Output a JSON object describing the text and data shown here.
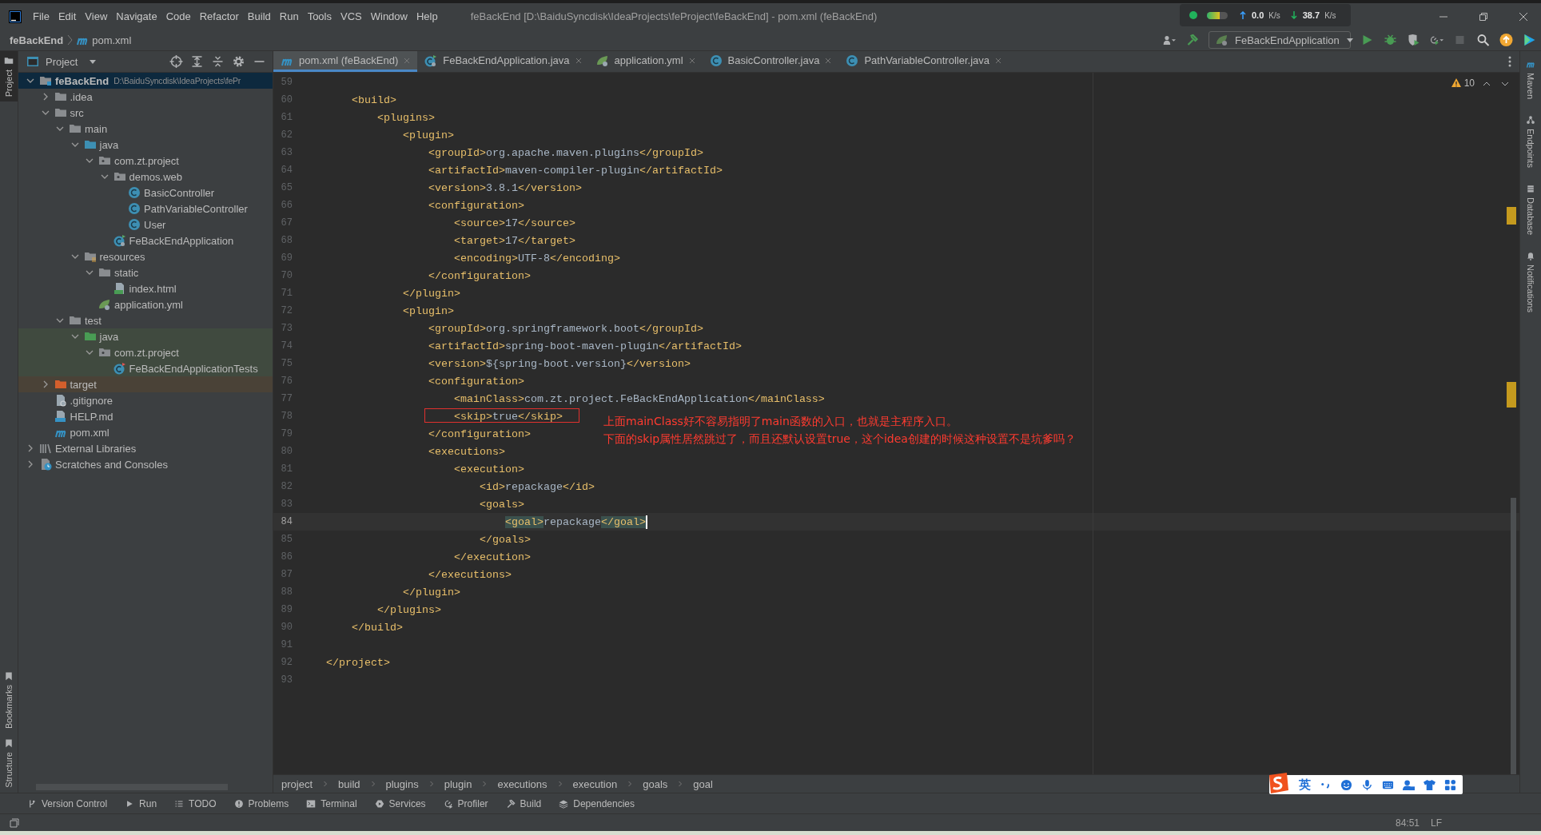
{
  "title_bar": {
    "menu": [
      "File",
      "Edit",
      "View",
      "Navigate",
      "Code",
      "Refactor",
      "Build",
      "Run",
      "Tools",
      "VCS",
      "Window",
      "Help"
    ],
    "title": "feBackEnd [D:\\BaiduSyncdisk\\IdeaProjects\\feProject\\feBackEnd] - pom.xml (feBackEnd)",
    "net_meter": {
      "level": 0.6,
      "up": "0.0",
      "up_unit": "K/s",
      "down": "38.7",
      "down_unit": "K/s"
    }
  },
  "nav_bar": {
    "crumbs": [
      "feBackEnd",
      "pom.xml"
    ],
    "run_config": "FeBackEndApplication"
  },
  "left_strip": {
    "top": [
      {
        "label": "Project",
        "selected": true
      }
    ],
    "bottom": [
      {
        "label": "Bookmarks",
        "selected": false
      },
      {
        "label": "Structure",
        "selected": false
      }
    ]
  },
  "project_panel": {
    "title": "Project",
    "tree": [
      {
        "label": "feBackEnd",
        "path": "D:\\BaiduSyncdisk\\IdeaProjects\\fePr",
        "kind": "module",
        "expanded": true,
        "selected": true,
        "children": [
          {
            "label": ".idea",
            "kind": "folder",
            "expanded": false,
            "selected": false
          },
          {
            "label": "src",
            "kind": "folder",
            "expanded": true,
            "selected": false,
            "children": [
              {
                "label": "main",
                "kind": "folder",
                "expanded": true,
                "selected": false,
                "children": [
                  {
                    "label": "java",
                    "kind": "source",
                    "expanded": true,
                    "selected": false,
                    "children": [
                      {
                        "label": "com.zt.project",
                        "kind": "package",
                        "expanded": true,
                        "selected": false,
                        "children": [
                          {
                            "label": "demos.web",
                            "kind": "package",
                            "expanded": true,
                            "selected": false,
                            "children": [
                              {
                                "label": "BasicController",
                                "kind": "class",
                                "selected": false
                              },
                              {
                                "label": "PathVariableController",
                                "kind": "class",
                                "selected": false
                              },
                              {
                                "label": "User",
                                "kind": "class",
                                "selected": false
                              }
                            ]
                          },
                          {
                            "label": "FeBackEndApplication",
                            "kind": "app-class",
                            "selected": false
                          }
                        ]
                      }
                    ]
                  },
                  {
                    "label": "resources",
                    "kind": "resources",
                    "expanded": true,
                    "selected": false,
                    "children": [
                      {
                        "label": "static",
                        "kind": "folder",
                        "expanded": true,
                        "selected": false,
                        "children": [
                          {
                            "label": "index.html",
                            "kind": "html",
                            "selected": false
                          }
                        ]
                      },
                      {
                        "label": "application.yml",
                        "kind": "yml",
                        "selected": false
                      }
                    ]
                  }
                ]
              },
              {
                "label": "test",
                "kind": "folder",
                "expanded": true,
                "selected": false,
                "children": [
                  {
                    "label": "java",
                    "kind": "test-source",
                    "expanded": true,
                    "selected": false,
                    "children": [
                      {
                        "label": "com.zt.project",
                        "kind": "package",
                        "expanded": true,
                        "selected": false,
                        "children": [
                          {
                            "label": "FeBackEndApplicationTests",
                            "kind": "test-class",
                            "selected": false
                          }
                        ]
                      }
                    ]
                  }
                ]
              }
            ]
          },
          {
            "label": "target",
            "kind": "excluded",
            "expanded": false,
            "selected": false
          },
          {
            "label": ".gitignore",
            "kind": "gitignore",
            "selected": false
          },
          {
            "label": "HELP.md",
            "kind": "md",
            "selected": false
          },
          {
            "label": "pom.xml",
            "kind": "maven",
            "selected": false
          }
        ]
      },
      {
        "label": "External Libraries",
        "kind": "libraries",
        "expanded": false,
        "selected": false
      },
      {
        "label": "Scratches and Consoles",
        "kind": "scratches",
        "expanded": false,
        "selected": false
      }
    ]
  },
  "tabs": [
    {
      "label": "pom.xml (feBackEnd)",
      "kind": "maven",
      "selected": true
    },
    {
      "label": "FeBackEndApplication.java",
      "kind": "app-class",
      "selected": false
    },
    {
      "label": "application.yml",
      "kind": "yml",
      "selected": false
    },
    {
      "label": "BasicController.java",
      "kind": "class",
      "selected": false
    },
    {
      "label": "PathVariableController.java",
      "kind": "class",
      "selected": false
    }
  ],
  "editor": {
    "warnings": "10",
    "lines": [
      {
        "n": "59"
      },
      {
        "n": "60",
        "text": "    <build>"
      },
      {
        "n": "61",
        "text": "        <plugins>"
      },
      {
        "n": "62",
        "text": "            <plugin>"
      },
      {
        "n": "63",
        "text": "                <groupId>org.apache.maven.plugins</groupId>"
      },
      {
        "n": "64",
        "text": "                <artifactId>maven-compiler-plugin</artifactId>"
      },
      {
        "n": "65",
        "text": "                <version>3.8.1</version>"
      },
      {
        "n": "66",
        "text": "                <configuration>"
      },
      {
        "n": "67",
        "text": "                    <source>17</source>"
      },
      {
        "n": "68",
        "text": "                    <target>17</target>"
      },
      {
        "n": "69",
        "text": "                    <encoding>UTF-8</encoding>"
      },
      {
        "n": "70",
        "text": "                </configuration>"
      },
      {
        "n": "71",
        "text": "            </plugin>"
      },
      {
        "n": "72",
        "text": "            <plugin>"
      },
      {
        "n": "73",
        "text": "                <groupId>org.springframework.boot</groupId>"
      },
      {
        "n": "74",
        "text": "                <artifactId>spring-boot-maven-plugin</artifactId>"
      },
      {
        "n": "75",
        "text": "                <version>${spring-boot.version}</version>"
      },
      {
        "n": "76",
        "text": "                <configuration>"
      },
      {
        "n": "77",
        "text": "                    <mainClass>com.zt.project.FeBackEndApplication</mainClass>"
      },
      {
        "n": "78",
        "text": "                    <skip>true</skip>",
        "boxed": true,
        "notes": [
          "上面mainClass好不容易指明了main函数的入口，也就是主程序入口。",
          "下面的skip属性居然跳过了，而且还默认设置true，这个idea创建的时候这种设置不是坑爹吗？"
        ]
      },
      {
        "n": "79",
        "text": "                </configuration>"
      },
      {
        "n": "80",
        "text": "                <executions>"
      },
      {
        "n": "81",
        "text": "                    <execution>"
      },
      {
        "n": "82",
        "text": "                        <id>repackage</id>"
      },
      {
        "n": "83",
        "text": "                        <goals>"
      },
      {
        "n": "84",
        "text": "                            <goal>repackage</goal>",
        "current": true
      },
      {
        "n": "85",
        "text": "                        </goals>"
      },
      {
        "n": "86",
        "text": "                    </execution>"
      },
      {
        "n": "87",
        "text": "                </executions>"
      },
      {
        "n": "88",
        "text": "            </plugin>"
      },
      {
        "n": "89",
        "text": "        </plugins>"
      },
      {
        "n": "90",
        "text": "    </build>"
      },
      {
        "n": "91"
      },
      {
        "n": "92",
        "text": "</project>"
      },
      {
        "n": "93"
      }
    ]
  },
  "breadcrumbs": [
    "project",
    "build",
    "plugins",
    "plugin",
    "executions",
    "execution",
    "goals",
    "goal"
  ],
  "right_strip": [
    {
      "label": "Maven",
      "kind": "maven"
    },
    {
      "label": "Endpoints",
      "kind": "endpoints"
    },
    {
      "label": "Database",
      "kind": "database"
    },
    {
      "label": "Notifications",
      "kind": "bell"
    }
  ],
  "tool_windows": [
    {
      "label": "Version Control",
      "kind": "vcs"
    },
    {
      "label": "Run",
      "kind": "run"
    },
    {
      "label": "TODO",
      "kind": "todo"
    },
    {
      "label": "Problems",
      "kind": "problems"
    },
    {
      "label": "Terminal",
      "kind": "terminal"
    },
    {
      "label": "Services",
      "kind": "services"
    },
    {
      "label": "Profiler",
      "kind": "profiler"
    },
    {
      "label": "Build",
      "kind": "build"
    },
    {
      "label": "Dependencies",
      "kind": "dependencies"
    }
  ],
  "status_bar": {
    "position": "84:51",
    "line_separator": "LF"
  },
  "ime_bar": {
    "mode": "英"
  }
}
